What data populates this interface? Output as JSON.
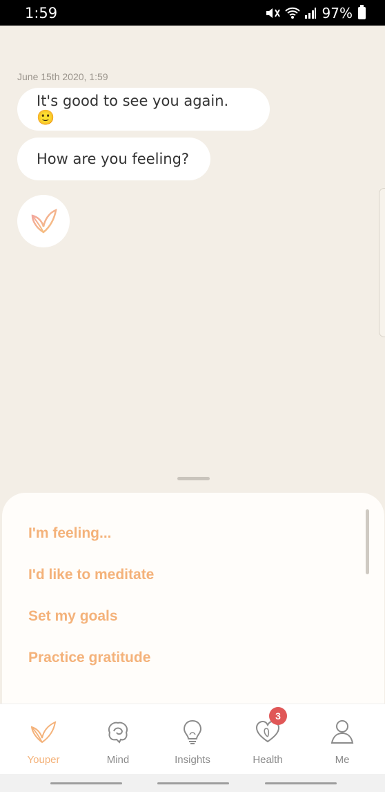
{
  "status": {
    "time": "1:59",
    "battery": "97%"
  },
  "chat": {
    "timestamp": "June 15th 2020, 1:59",
    "messages": [
      "It's good to see you again. 🙂",
      "How are you feeling?"
    ]
  },
  "suggestions": [
    "I'm feeling...",
    "I'd like to meditate",
    "Set my goals",
    "Practice gratitude"
  ],
  "tabs": [
    {
      "label": "Youper",
      "icon": "youper-leaf-icon",
      "active": true
    },
    {
      "label": "Mind",
      "icon": "brain-icon"
    },
    {
      "label": "Insights",
      "icon": "lightbulb-icon"
    },
    {
      "label": "Health",
      "icon": "heart-icon",
      "badge": "3"
    },
    {
      "label": "Me",
      "icon": "person-icon"
    }
  ],
  "colors": {
    "accent": "#f4b27a",
    "background": "#f3eee6",
    "badge": "#e05757"
  }
}
